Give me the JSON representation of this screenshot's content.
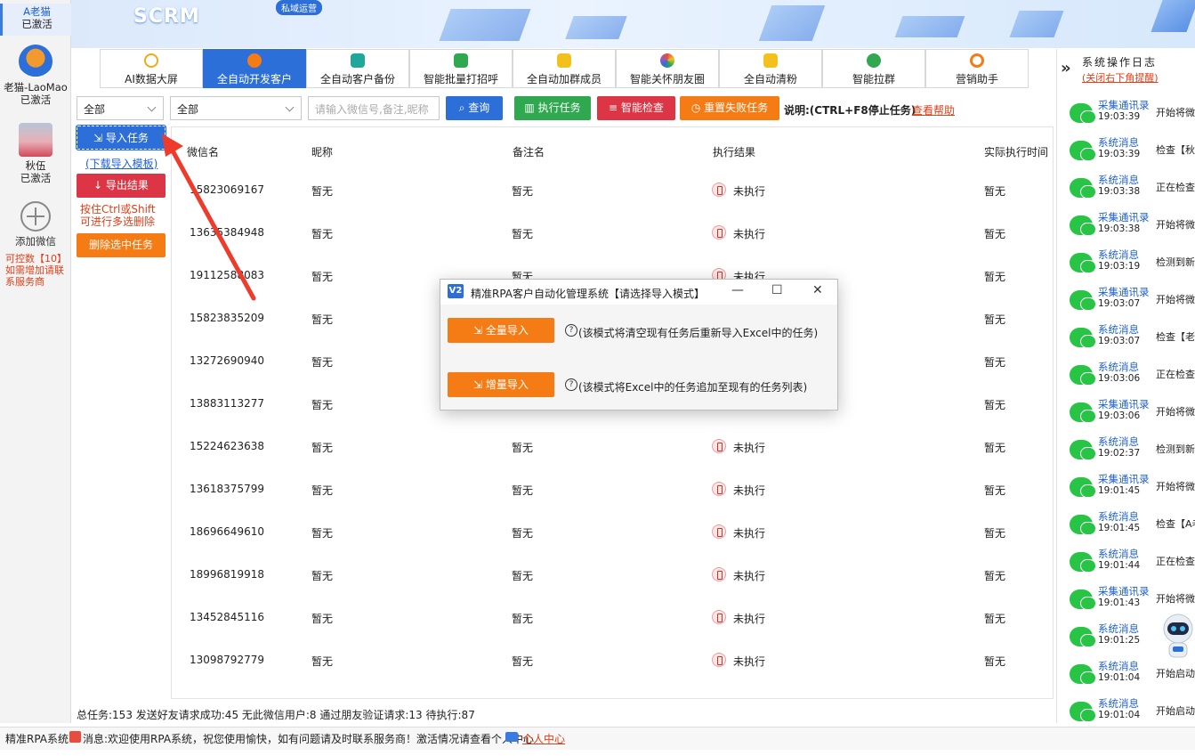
{
  "accounts": [
    {
      "name": "A老猫",
      "status": "已激活"
    },
    {
      "name": "老猫-LaoMao",
      "status": "已激活"
    },
    {
      "name": "秋伍",
      "status": "已激活"
    }
  ],
  "add_wechat": {
    "label": "添加微信",
    "limit": "可控数【10】如需增加请联系服务商"
  },
  "banner": {
    "title": "SCRM",
    "tag": "私域运营"
  },
  "nav": {
    "tabs": [
      "AI数据大屏",
      "全自动开发客户",
      "全自动客户备份",
      "智能批量打招呼",
      "全自动加群成员",
      "智能关怀朋友圈",
      "全自动清粉",
      "智能拉群",
      "营销助手"
    ],
    "active_index": 1
  },
  "toolbar": {
    "filter1": "全部",
    "filter2": "全部",
    "search_placeholder": "请输入微信号,备注,昵称",
    "query": "查询",
    "execute": "执行任务",
    "smart_check": "智能检查",
    "reset_failed": "重置失败任务",
    "hint": "说明:(CTRL+F8停止任务)",
    "help": "查看帮助"
  },
  "side_actions": {
    "import": "导入任务",
    "download_template": "(下载导入模板)",
    "export": "导出结果",
    "multi_select_hint": "按住Ctrl或Shift可进行多选删除",
    "delete_selected": "删除选中任务"
  },
  "table": {
    "headers": [
      "微信名",
      "昵称",
      "备注名",
      "执行结果",
      "实际执行时间"
    ],
    "rows": [
      {
        "wx": "15823069167",
        "nick": "暂无",
        "remark": "暂无",
        "result": "未执行",
        "time": "暂无"
      },
      {
        "wx": "13635384948",
        "nick": "暂无",
        "remark": "暂无",
        "result": "未执行",
        "time": "暂无"
      },
      {
        "wx": "19112588083",
        "nick": "暂无",
        "remark": "暂无",
        "result": "未执行",
        "time": "暂无"
      },
      {
        "wx": "15823835209",
        "nick": "暂无",
        "remark": "",
        "result": "",
        "time": "暂无"
      },
      {
        "wx": "13272690940",
        "nick": "暂无",
        "remark": "",
        "result": "",
        "time": "暂无"
      },
      {
        "wx": "13883113277",
        "nick": "暂无",
        "remark": "",
        "result": "",
        "time": "暂无"
      },
      {
        "wx": "15224623638",
        "nick": "暂无",
        "remark": "暂无",
        "result": "未执行",
        "time": "暂无"
      },
      {
        "wx": "13618375799",
        "nick": "暂无",
        "remark": "暂无",
        "result": "未执行",
        "time": "暂无"
      },
      {
        "wx": "18696649610",
        "nick": "暂无",
        "remark": "暂无",
        "result": "未执行",
        "time": "暂无"
      },
      {
        "wx": "18996819918",
        "nick": "暂无",
        "remark": "暂无",
        "result": "未执行",
        "time": "暂无"
      },
      {
        "wx": "13452845116",
        "nick": "暂无",
        "remark": "暂无",
        "result": "未执行",
        "time": "暂无"
      },
      {
        "wx": "13098792779",
        "nick": "暂无",
        "remark": "暂无",
        "result": "未执行",
        "time": "暂无"
      }
    ]
  },
  "totals": "总任务:153 发送好友请求成功:45 无此微信用户:8 通过朋友验证请求:13 待执行:87",
  "log": {
    "title": "系统操作日志",
    "close_hint": "(关闭右下角提醒)",
    "items": [
      {
        "type": "采集通讯录",
        "time": "19:03:39",
        "text": "开始将微"
      },
      {
        "type": "系统消息",
        "time": "19:03:39",
        "text": "检查【秋"
      },
      {
        "type": "系统消息",
        "time": "19:03:38",
        "text": "正在检查"
      },
      {
        "type": "采集通讯录",
        "time": "19:03:38",
        "text": "开始将微"
      },
      {
        "type": "系统消息",
        "time": "19:03:19",
        "text": "检测到新"
      },
      {
        "type": "采集通讯录",
        "time": "19:03:07",
        "text": "开始将微"
      },
      {
        "type": "系统消息",
        "time": "19:03:07",
        "text": "检查【老"
      },
      {
        "type": "系统消息",
        "time": "19:03:06",
        "text": "正在检查"
      },
      {
        "type": "采集通讯录",
        "time": "19:03:06",
        "text": "开始将微"
      },
      {
        "type": "系统消息",
        "time": "19:02:37",
        "text": "检测到新"
      },
      {
        "type": "采集通讯录",
        "time": "19:01:45",
        "text": "开始将微"
      },
      {
        "type": "系统消息",
        "time": "19:01:45",
        "text": "检查【A老"
      },
      {
        "type": "系统消息",
        "time": "19:01:44",
        "text": "正在检查"
      },
      {
        "type": "采集通讯录",
        "time": "19:01:43",
        "text": "开始将微"
      },
      {
        "type": "系统消息",
        "time": "19:01:25",
        "text": ""
      },
      {
        "type": "系统消息",
        "time": "19:01:04",
        "text": "开始启动"
      },
      {
        "type": "系统消息",
        "time": "19:01:04",
        "text": "开始启动"
      }
    ]
  },
  "footer": {
    "app": "精准RPA系统",
    "message": "消息:欢迎使用RPA系统，祝您使用愉快，如有问题请及时联系服务商！激活情况请查看个人中心",
    "personal": "个人中心"
  },
  "modal": {
    "logo": "V2",
    "title": "精准RPA客户自动化管理系统【请选择导入模式】",
    "full_import": "全量导入",
    "full_desc": "(该模式将清空现有任务后重新导入Excel中的任务)",
    "inc_import": "增量导入",
    "inc_desc": "(该模式将Excel中的任务追加至现有的任务列表)"
  },
  "colors": {
    "primary": "#2d6fd8",
    "green": "#2fa84f",
    "red": "#dc3545",
    "orange": "#f57c15",
    "link_red": "#e0401a"
  }
}
